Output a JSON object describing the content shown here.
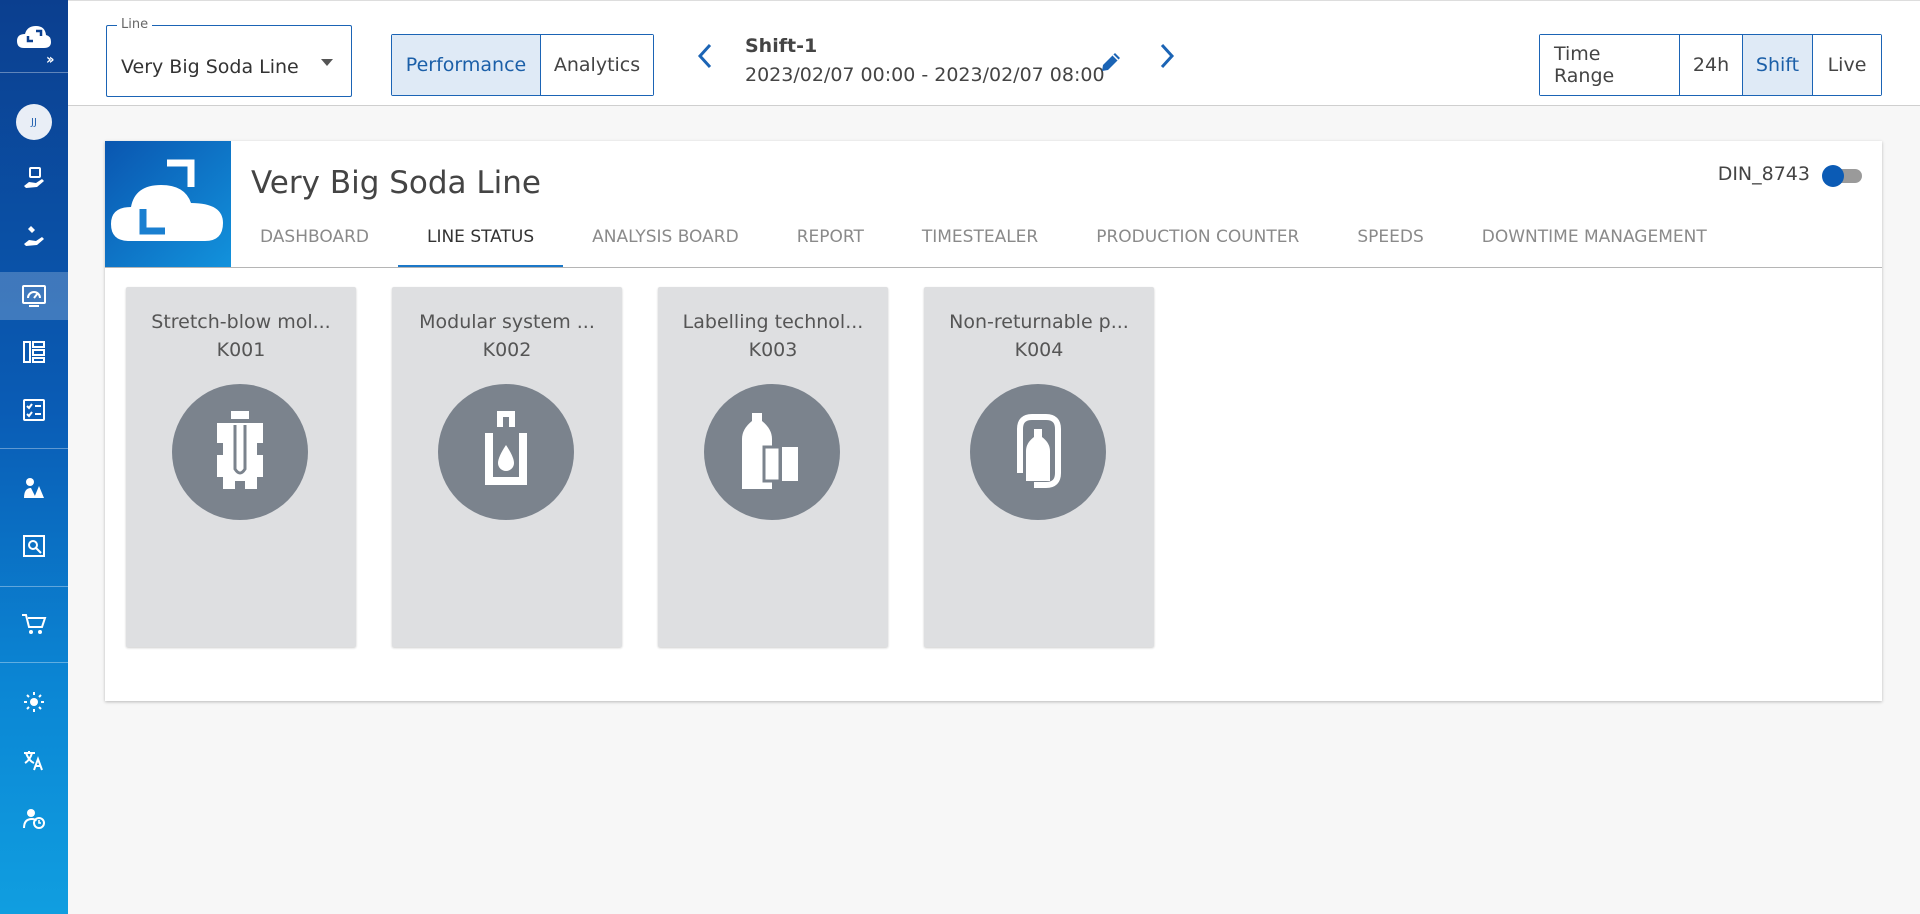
{
  "sidebar": {
    "avatar_initials": "JJ",
    "expand_icon": "chevron-double-right-icon",
    "items": [
      {
        "icon": "cloud-logo-icon"
      },
      {
        "icon": "hand-settings-icon"
      },
      {
        "icon": "hand-wrench-icon"
      },
      {
        "icon": "gauge-monitor-icon",
        "active": true
      },
      {
        "icon": "hierarchy-icon"
      },
      {
        "icon": "checklist-icon"
      },
      {
        "icon": "worker-icon"
      },
      {
        "icon": "search-document-icon"
      },
      {
        "icon": "cart-icon"
      },
      {
        "icon": "brightness-icon"
      },
      {
        "icon": "translate-icon"
      },
      {
        "icon": "user-clock-icon"
      }
    ]
  },
  "topbar": {
    "line_select": {
      "legend": "Line",
      "value": "Very Big Soda Line"
    },
    "view_toggle": {
      "performance": "Performance",
      "analytics": "Analytics",
      "selected": "Performance"
    },
    "shift": {
      "title": "Shift-1",
      "range": "2023/02/07 00:00 - 2023/02/07 08:00"
    },
    "time_toggle": {
      "time_range": "Time Range",
      "h24": "24h",
      "shift": "Shift",
      "live": "Live",
      "selected": "Shift"
    }
  },
  "card": {
    "title": "Very Big Soda Line",
    "din_label": "DIN_8743",
    "tabs": [
      "DASHBOARD",
      "LINE STATUS",
      "ANALYSIS BOARD",
      "REPORT",
      "TIMESTEALER",
      "PRODUCTION COUNTER",
      "SPEEDS",
      "DOWNTIME MANAGEMENT"
    ],
    "active_tab": "LINE STATUS",
    "machines": [
      {
        "name": "Stretch-blow mol...",
        "code": "K001",
        "icon": "stretch-blow-molder-icon"
      },
      {
        "name": "Modular system ...",
        "code": "K002",
        "icon": "filler-icon"
      },
      {
        "name": "Labelling technol...",
        "code": "K003",
        "icon": "labeller-icon"
      },
      {
        "name": "Non-returnable p...",
        "code": "K004",
        "icon": "packer-icon"
      }
    ]
  },
  "colors": {
    "accent": "#1b64b5",
    "tab_underline": "#1b78c8",
    "machine_tile": "#dedfe1",
    "machine_icon_bg": "#7b838d"
  }
}
